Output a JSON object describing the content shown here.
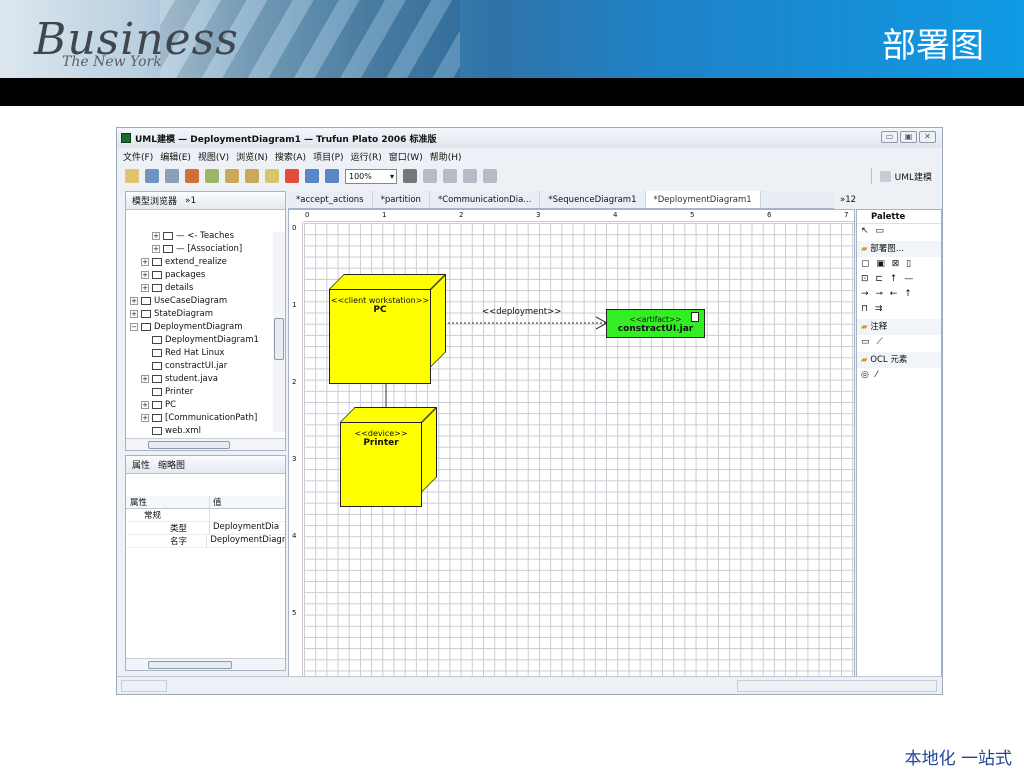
{
  "slide": {
    "title": "部署图",
    "banner_word": "Business",
    "banner_sub": "The New York",
    "footer": "本地化  一站式"
  },
  "window": {
    "title": "UML建模 — DeploymentDiagram1 — Trufun Plato 2006 标准版",
    "menu": [
      "文件(F)",
      "编辑(E)",
      "视图(V)",
      "浏览(N)",
      "搜索(A)",
      "项目(P)",
      "运行(R)",
      "窗口(W)",
      "帮助(H)"
    ],
    "zoom": "100%",
    "perspective": "UML建模"
  },
  "explorer": {
    "tab": "模型浏览器",
    "tab_extra": "»1",
    "tree": [
      {
        "indent": 4,
        "exp": "+",
        "label": "— <- Teaches"
      },
      {
        "indent": 4,
        "exp": "+",
        "label": "— [Association]"
      },
      {
        "indent": 3,
        "exp": "+",
        "label": "extend_realize"
      },
      {
        "indent": 3,
        "exp": "+",
        "label": "packages"
      },
      {
        "indent": 3,
        "exp": "+",
        "label": "details"
      },
      {
        "indent": 2,
        "exp": "+",
        "label": "UseCaseDiagram"
      },
      {
        "indent": 2,
        "exp": "+",
        "label": "StateDiagram"
      },
      {
        "indent": 2,
        "exp": "−",
        "label": "DeploymentDiagram"
      },
      {
        "indent": 3,
        "exp": "",
        "label": "DeploymentDiagram1"
      },
      {
        "indent": 3,
        "exp": "",
        "label": "Red Hat Linux"
      },
      {
        "indent": 3,
        "exp": "",
        "label": "constractUI.jar"
      },
      {
        "indent": 3,
        "exp": "+",
        "label": "student.java"
      },
      {
        "indent": 3,
        "exp": "",
        "label": "Printer"
      },
      {
        "indent": 3,
        "exp": "+",
        "label": "PC"
      },
      {
        "indent": 3,
        "exp": "+",
        "label": "[CommunicationPath]"
      },
      {
        "indent": 3,
        "exp": "",
        "label": "web.xml"
      }
    ]
  },
  "properties": {
    "tab": "属性",
    "tab2": "缩略图",
    "col_property": "属性",
    "col_value": "值",
    "group": "常规",
    "rows": [
      {
        "name": "类型",
        "value": "DeploymentDia"
      },
      {
        "name": "名字",
        "value": "DeploymentDiagra"
      }
    ]
  },
  "editor_tabs": [
    {
      "label": "*accept_actions",
      "active": false
    },
    {
      "label": "*partition",
      "active": false
    },
    {
      "label": "*CommunicationDia...",
      "active": false
    },
    {
      "label": "*SequenceDiagram1",
      "active": false
    },
    {
      "label": "*DeploymentDiagram1",
      "active": true
    }
  ],
  "editor_tabs_more": "»12",
  "diagram": {
    "pc_stereotype": "<<client workstation>>",
    "pc_name": "PC",
    "printer_stereotype": "<<device>>",
    "printer_name": "Printer",
    "artifact_stereotype": "<<artifact>>",
    "artifact_name": "constractUI.jar",
    "dependency_label": "<<deployment>>",
    "ruler_h": [
      "0",
      "1",
      "2",
      "3",
      "4",
      "5",
      "6",
      "7"
    ],
    "ruler_v": [
      "0",
      "1",
      "2",
      "3",
      "4",
      "5"
    ],
    "colors": {
      "node": "#ffff00",
      "artifact": "#33ee22"
    }
  },
  "palette": {
    "header": "Palette",
    "sections": [
      {
        "label": "部署图...",
        "icons": "▢ ▣ ⊠ ▯"
      },
      {
        "label": "注释",
        "icons": "▭ ⟋"
      },
      {
        "label": "OCL 元素",
        "icons": "◎ ⁄"
      }
    ],
    "top_icons": "↖ ▭",
    "deploy_icons_2": "⊡ ⊏ ↑ —",
    "deploy_icons_3": "→ ⊸ ← ↑",
    "deploy_icons_4": "⊓ ⇉"
  }
}
